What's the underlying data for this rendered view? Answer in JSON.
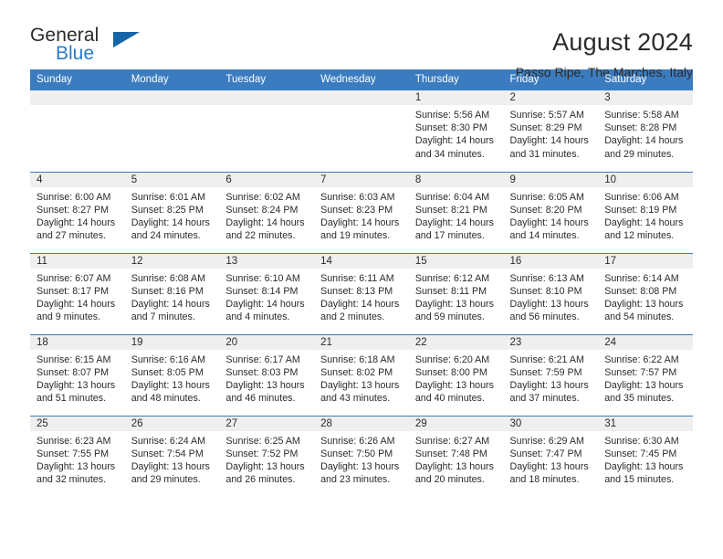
{
  "brand": {
    "name_top": "General",
    "name_bottom": "Blue",
    "accent_color": "#2a7cc7",
    "triangle_color": "#1565a8"
  },
  "header": {
    "title": "August 2024",
    "subtitle": "Passo Ripe, The Marches, Italy"
  },
  "theme": {
    "header_bar_color": "#3b7cc0",
    "daynum_band_color": "#efefef",
    "text_color": "#2b2b2b"
  },
  "weekday_headers": [
    "Sunday",
    "Monday",
    "Tuesday",
    "Wednesday",
    "Thursday",
    "Friday",
    "Saturday"
  ],
  "weeks": [
    [
      {
        "day": "",
        "empty": true,
        "sunrise": "",
        "sunset": "",
        "daylight_line1": "",
        "daylight_line2": ""
      },
      {
        "day": "",
        "empty": true,
        "sunrise": "",
        "sunset": "",
        "daylight_line1": "",
        "daylight_line2": ""
      },
      {
        "day": "",
        "empty": true,
        "sunrise": "",
        "sunset": "",
        "daylight_line1": "",
        "daylight_line2": ""
      },
      {
        "day": "",
        "empty": true,
        "sunrise": "",
        "sunset": "",
        "daylight_line1": "",
        "daylight_line2": ""
      },
      {
        "day": "1",
        "empty": false,
        "sunrise": "Sunrise: 5:56 AM",
        "sunset": "Sunset: 8:30 PM",
        "daylight_line1": "Daylight: 14 hours",
        "daylight_line2": "and 34 minutes."
      },
      {
        "day": "2",
        "empty": false,
        "sunrise": "Sunrise: 5:57 AM",
        "sunset": "Sunset: 8:29 PM",
        "daylight_line1": "Daylight: 14 hours",
        "daylight_line2": "and 31 minutes."
      },
      {
        "day": "3",
        "empty": false,
        "sunrise": "Sunrise: 5:58 AM",
        "sunset": "Sunset: 8:28 PM",
        "daylight_line1": "Daylight: 14 hours",
        "daylight_line2": "and 29 minutes."
      }
    ],
    [
      {
        "day": "4",
        "empty": false,
        "sunrise": "Sunrise: 6:00 AM",
        "sunset": "Sunset: 8:27 PM",
        "daylight_line1": "Daylight: 14 hours",
        "daylight_line2": "and 27 minutes."
      },
      {
        "day": "5",
        "empty": false,
        "sunrise": "Sunrise: 6:01 AM",
        "sunset": "Sunset: 8:25 PM",
        "daylight_line1": "Daylight: 14 hours",
        "daylight_line2": "and 24 minutes."
      },
      {
        "day": "6",
        "empty": false,
        "sunrise": "Sunrise: 6:02 AM",
        "sunset": "Sunset: 8:24 PM",
        "daylight_line1": "Daylight: 14 hours",
        "daylight_line2": "and 22 minutes."
      },
      {
        "day": "7",
        "empty": false,
        "sunrise": "Sunrise: 6:03 AM",
        "sunset": "Sunset: 8:23 PM",
        "daylight_line1": "Daylight: 14 hours",
        "daylight_line2": "and 19 minutes."
      },
      {
        "day": "8",
        "empty": false,
        "sunrise": "Sunrise: 6:04 AM",
        "sunset": "Sunset: 8:21 PM",
        "daylight_line1": "Daylight: 14 hours",
        "daylight_line2": "and 17 minutes."
      },
      {
        "day": "9",
        "empty": false,
        "sunrise": "Sunrise: 6:05 AM",
        "sunset": "Sunset: 8:20 PM",
        "daylight_line1": "Daylight: 14 hours",
        "daylight_line2": "and 14 minutes."
      },
      {
        "day": "10",
        "empty": false,
        "sunrise": "Sunrise: 6:06 AM",
        "sunset": "Sunset: 8:19 PM",
        "daylight_line1": "Daylight: 14 hours",
        "daylight_line2": "and 12 minutes."
      }
    ],
    [
      {
        "day": "11",
        "empty": false,
        "sunrise": "Sunrise: 6:07 AM",
        "sunset": "Sunset: 8:17 PM",
        "daylight_line1": "Daylight: 14 hours",
        "daylight_line2": "and 9 minutes."
      },
      {
        "day": "12",
        "empty": false,
        "sunrise": "Sunrise: 6:08 AM",
        "sunset": "Sunset: 8:16 PM",
        "daylight_line1": "Daylight: 14 hours",
        "daylight_line2": "and 7 minutes."
      },
      {
        "day": "13",
        "empty": false,
        "sunrise": "Sunrise: 6:10 AM",
        "sunset": "Sunset: 8:14 PM",
        "daylight_line1": "Daylight: 14 hours",
        "daylight_line2": "and 4 minutes."
      },
      {
        "day": "14",
        "empty": false,
        "sunrise": "Sunrise: 6:11 AM",
        "sunset": "Sunset: 8:13 PM",
        "daylight_line1": "Daylight: 14 hours",
        "daylight_line2": "and 2 minutes."
      },
      {
        "day": "15",
        "empty": false,
        "sunrise": "Sunrise: 6:12 AM",
        "sunset": "Sunset: 8:11 PM",
        "daylight_line1": "Daylight: 13 hours",
        "daylight_line2": "and 59 minutes."
      },
      {
        "day": "16",
        "empty": false,
        "sunrise": "Sunrise: 6:13 AM",
        "sunset": "Sunset: 8:10 PM",
        "daylight_line1": "Daylight: 13 hours",
        "daylight_line2": "and 56 minutes."
      },
      {
        "day": "17",
        "empty": false,
        "sunrise": "Sunrise: 6:14 AM",
        "sunset": "Sunset: 8:08 PM",
        "daylight_line1": "Daylight: 13 hours",
        "daylight_line2": "and 54 minutes."
      }
    ],
    [
      {
        "day": "18",
        "empty": false,
        "sunrise": "Sunrise: 6:15 AM",
        "sunset": "Sunset: 8:07 PM",
        "daylight_line1": "Daylight: 13 hours",
        "daylight_line2": "and 51 minutes."
      },
      {
        "day": "19",
        "empty": false,
        "sunrise": "Sunrise: 6:16 AM",
        "sunset": "Sunset: 8:05 PM",
        "daylight_line1": "Daylight: 13 hours",
        "daylight_line2": "and 48 minutes."
      },
      {
        "day": "20",
        "empty": false,
        "sunrise": "Sunrise: 6:17 AM",
        "sunset": "Sunset: 8:03 PM",
        "daylight_line1": "Daylight: 13 hours",
        "daylight_line2": "and 46 minutes."
      },
      {
        "day": "21",
        "empty": false,
        "sunrise": "Sunrise: 6:18 AM",
        "sunset": "Sunset: 8:02 PM",
        "daylight_line1": "Daylight: 13 hours",
        "daylight_line2": "and 43 minutes."
      },
      {
        "day": "22",
        "empty": false,
        "sunrise": "Sunrise: 6:20 AM",
        "sunset": "Sunset: 8:00 PM",
        "daylight_line1": "Daylight: 13 hours",
        "daylight_line2": "and 40 minutes."
      },
      {
        "day": "23",
        "empty": false,
        "sunrise": "Sunrise: 6:21 AM",
        "sunset": "Sunset: 7:59 PM",
        "daylight_line1": "Daylight: 13 hours",
        "daylight_line2": "and 37 minutes."
      },
      {
        "day": "24",
        "empty": false,
        "sunrise": "Sunrise: 6:22 AM",
        "sunset": "Sunset: 7:57 PM",
        "daylight_line1": "Daylight: 13 hours",
        "daylight_line2": "and 35 minutes."
      }
    ],
    [
      {
        "day": "25",
        "empty": false,
        "sunrise": "Sunrise: 6:23 AM",
        "sunset": "Sunset: 7:55 PM",
        "daylight_line1": "Daylight: 13 hours",
        "daylight_line2": "and 32 minutes."
      },
      {
        "day": "26",
        "empty": false,
        "sunrise": "Sunrise: 6:24 AM",
        "sunset": "Sunset: 7:54 PM",
        "daylight_line1": "Daylight: 13 hours",
        "daylight_line2": "and 29 minutes."
      },
      {
        "day": "27",
        "empty": false,
        "sunrise": "Sunrise: 6:25 AM",
        "sunset": "Sunset: 7:52 PM",
        "daylight_line1": "Daylight: 13 hours",
        "daylight_line2": "and 26 minutes."
      },
      {
        "day": "28",
        "empty": false,
        "sunrise": "Sunrise: 6:26 AM",
        "sunset": "Sunset: 7:50 PM",
        "daylight_line1": "Daylight: 13 hours",
        "daylight_line2": "and 23 minutes."
      },
      {
        "day": "29",
        "empty": false,
        "sunrise": "Sunrise: 6:27 AM",
        "sunset": "Sunset: 7:48 PM",
        "daylight_line1": "Daylight: 13 hours",
        "daylight_line2": "and 20 minutes."
      },
      {
        "day": "30",
        "empty": false,
        "sunrise": "Sunrise: 6:29 AM",
        "sunset": "Sunset: 7:47 PM",
        "daylight_line1": "Daylight: 13 hours",
        "daylight_line2": "and 18 minutes."
      },
      {
        "day": "31",
        "empty": false,
        "sunrise": "Sunrise: 6:30 AM",
        "sunset": "Sunset: 7:45 PM",
        "daylight_line1": "Daylight: 13 hours",
        "daylight_line2": "and 15 minutes."
      }
    ]
  ]
}
